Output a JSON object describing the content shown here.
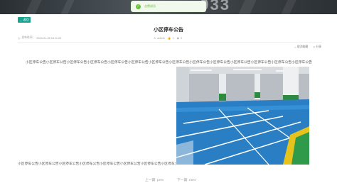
{
  "toast": {
    "message": "点赞成功"
  },
  "header": {
    "back_label": "返回"
  },
  "article": {
    "title": "小区停车公告",
    "publish_label": "发布时间：",
    "publish_time": "2024-01-26 16:11:00",
    "author": "admin",
    "like_count": "1",
    "view_count": "0"
  },
  "actions": {
    "favorite_label": "取消收藏",
    "share_label": "分享"
  },
  "content": {
    "paragraph1": "小区停车公告小区停车公告小区停车公告小区停车公告小区停车公告小区停车公告小区停车公告小区停车公告小区停车公告小区停车公告小区停车公告小区停车公告小区停车公告小区停车公告",
    "paragraph2": "小区停车公告小区停车公告小区停车公告小区停车公告小区停车公告小区停车公告小区停车公告小区停车公告小区停车公告"
  },
  "pager": {
    "prev_label": "上一篇: prev",
    "next_label": "下一篇: next"
  },
  "colors": {
    "accent": "#1aa38f",
    "success": "#67c23a",
    "floor": "#2a7fc4"
  }
}
